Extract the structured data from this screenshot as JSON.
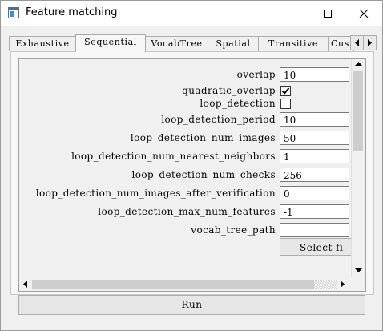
{
  "window": {
    "title": "Feature matching",
    "controls": {
      "minimize_icon": "minimize-icon",
      "maximize_icon": "maximize-icon",
      "close_icon": "close-icon"
    }
  },
  "tabs": [
    {
      "label": "Exhaustive",
      "active": false
    },
    {
      "label": "Sequential",
      "active": true
    },
    {
      "label": "VocabTree",
      "active": false
    },
    {
      "label": "Spatial",
      "active": false
    },
    {
      "label": "Transitive",
      "active": false
    },
    {
      "label": "Cus",
      "active": false
    }
  ],
  "options": [
    {
      "label": "overlap",
      "type": "text",
      "value": "10"
    },
    {
      "label": "quadratic_overlap",
      "type": "checkbox",
      "checked": true
    },
    {
      "label": "loop_detection",
      "type": "checkbox",
      "checked": false
    },
    {
      "label": "loop_detection_period",
      "type": "text",
      "value": "10"
    },
    {
      "label": "loop_detection_num_images",
      "type": "text",
      "value": "50"
    },
    {
      "label": "loop_detection_num_nearest_neighbors",
      "type": "text",
      "value": "1"
    },
    {
      "label": "loop_detection_num_checks",
      "type": "text",
      "value": "256"
    },
    {
      "label": "loop_detection_num_images_after_verification",
      "type": "text",
      "value": "0"
    },
    {
      "label": "loop_detection_max_num_features",
      "type": "text",
      "value": "-1"
    },
    {
      "label": "vocab_tree_path",
      "type": "text",
      "value": ""
    }
  ],
  "select_file_button": "Select fi",
  "run_button": "Run"
}
